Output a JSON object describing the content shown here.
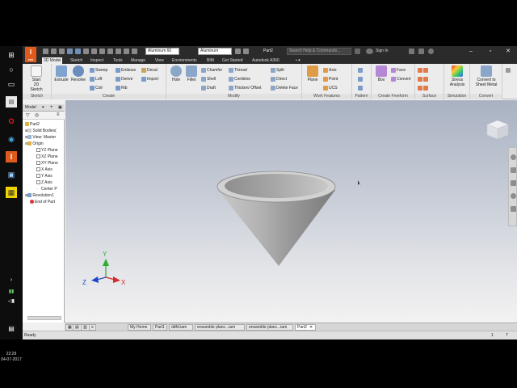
{
  "taskbar": {
    "time": "22:29",
    "date": "04-07-2017"
  },
  "app": {
    "logo_letter": "I",
    "logo_sub": "PRO",
    "material": "Aluminum 60",
    "appearance": "Aluminum",
    "doc_title": "Part2",
    "search_placeholder": "Search Help & Commands...",
    "sign_in": "Sign In"
  },
  "tabs": [
    "3D Model",
    "Sketch",
    "Inspect",
    "Tools",
    "Manage",
    "View",
    "Environments",
    "BIM",
    "Get Started",
    "Autodesk A360"
  ],
  "ribbon": {
    "sketch": {
      "title": "Sketch",
      "start": "Start",
      "start2": "2D Sketch"
    },
    "create": {
      "title": "Create",
      "extrude": "Extrude",
      "revolve": "Revolve",
      "sweep": "Sweep",
      "loft": "Loft",
      "coil": "Coil",
      "emboss": "Emboss",
      "derive": "Derive",
      "rib": "Rib",
      "decal": "Decal",
      "import": "Import"
    },
    "modify": {
      "title": "Modify",
      "hole": "Hole",
      "fillet": "Fillet",
      "chamfer": "Chamfer",
      "shell": "Shell",
      "draft": "Draft",
      "thread": "Thread",
      "combine": "Combine",
      "thicken": "Thicken/ Offset",
      "split": "Split",
      "direct": "Direct",
      "delete_face": "Delete Face"
    },
    "work": {
      "title": "Work Features",
      "plane": "Plane",
      "axis": "Axis",
      "point": "Point",
      "ucs": "UCS"
    },
    "pattern": {
      "title": "Pattern"
    },
    "freeform": {
      "title": "Create Freeform",
      "box": "Box",
      "face": "Face",
      "convert": "Convert"
    },
    "surface": {
      "title": "Surface"
    },
    "simulation": {
      "title": "Simulation",
      "stress": "Stress",
      "stress2": "Analysis"
    },
    "convert": {
      "title": "Convert",
      "sheet": "Convert to",
      "sheet2": "Sheet Metal"
    }
  },
  "browser": {
    "header": "Model",
    "items": [
      "Part2",
      "Solid Bodies(",
      "View: Master",
      "Origin",
      "YZ Plane",
      "XZ Plane",
      "XY Plane",
      "X Axis",
      "Y Axis",
      "Z Axis",
      "Center P",
      "Revolution1",
      "End of Part"
    ]
  },
  "triad": {
    "x": "X",
    "y": "Y",
    "z": "Z"
  },
  "doc_tabs": [
    "My Home",
    "Part1",
    "ddfd.iam",
    "ensamble planc...iam",
    "ensamble planc...iam",
    "Part2"
  ],
  "status": {
    "text": "Ready",
    "count1": "1",
    "count2": "7"
  },
  "colors": {
    "logo": "#e05a1e",
    "titlebar": "#2b2b2b",
    "cone": "#9d9d9d"
  }
}
